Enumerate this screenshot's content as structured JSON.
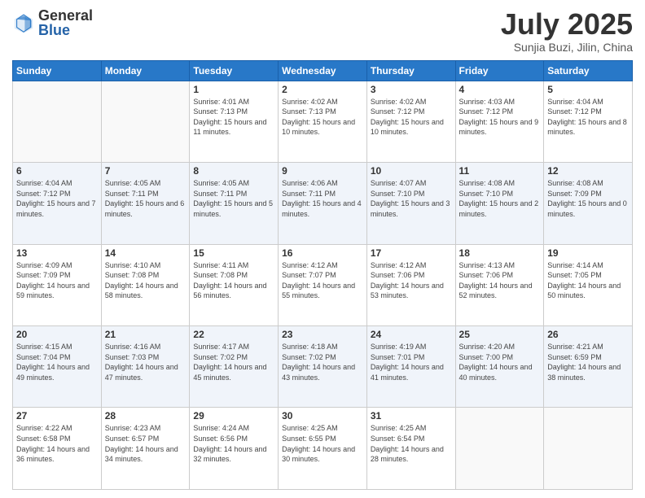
{
  "logo": {
    "general": "General",
    "blue": "Blue"
  },
  "header": {
    "month": "July 2025",
    "location": "Sunjia Buzi, Jilin, China"
  },
  "days_of_week": [
    "Sunday",
    "Monday",
    "Tuesday",
    "Wednesday",
    "Thursday",
    "Friday",
    "Saturday"
  ],
  "weeks": [
    [
      {
        "day": "",
        "info": ""
      },
      {
        "day": "",
        "info": ""
      },
      {
        "day": "1",
        "info": "Sunrise: 4:01 AM\nSunset: 7:13 PM\nDaylight: 15 hours and 11 minutes."
      },
      {
        "day": "2",
        "info": "Sunrise: 4:02 AM\nSunset: 7:13 PM\nDaylight: 15 hours and 10 minutes."
      },
      {
        "day": "3",
        "info": "Sunrise: 4:02 AM\nSunset: 7:12 PM\nDaylight: 15 hours and 10 minutes."
      },
      {
        "day": "4",
        "info": "Sunrise: 4:03 AM\nSunset: 7:12 PM\nDaylight: 15 hours and 9 minutes."
      },
      {
        "day": "5",
        "info": "Sunrise: 4:04 AM\nSunset: 7:12 PM\nDaylight: 15 hours and 8 minutes."
      }
    ],
    [
      {
        "day": "6",
        "info": "Sunrise: 4:04 AM\nSunset: 7:12 PM\nDaylight: 15 hours and 7 minutes."
      },
      {
        "day": "7",
        "info": "Sunrise: 4:05 AM\nSunset: 7:11 PM\nDaylight: 15 hours and 6 minutes."
      },
      {
        "day": "8",
        "info": "Sunrise: 4:05 AM\nSunset: 7:11 PM\nDaylight: 15 hours and 5 minutes."
      },
      {
        "day": "9",
        "info": "Sunrise: 4:06 AM\nSunset: 7:11 PM\nDaylight: 15 hours and 4 minutes."
      },
      {
        "day": "10",
        "info": "Sunrise: 4:07 AM\nSunset: 7:10 PM\nDaylight: 15 hours and 3 minutes."
      },
      {
        "day": "11",
        "info": "Sunrise: 4:08 AM\nSunset: 7:10 PM\nDaylight: 15 hours and 2 minutes."
      },
      {
        "day": "12",
        "info": "Sunrise: 4:08 AM\nSunset: 7:09 PM\nDaylight: 15 hours and 0 minutes."
      }
    ],
    [
      {
        "day": "13",
        "info": "Sunrise: 4:09 AM\nSunset: 7:09 PM\nDaylight: 14 hours and 59 minutes."
      },
      {
        "day": "14",
        "info": "Sunrise: 4:10 AM\nSunset: 7:08 PM\nDaylight: 14 hours and 58 minutes."
      },
      {
        "day": "15",
        "info": "Sunrise: 4:11 AM\nSunset: 7:08 PM\nDaylight: 14 hours and 56 minutes."
      },
      {
        "day": "16",
        "info": "Sunrise: 4:12 AM\nSunset: 7:07 PM\nDaylight: 14 hours and 55 minutes."
      },
      {
        "day": "17",
        "info": "Sunrise: 4:12 AM\nSunset: 7:06 PM\nDaylight: 14 hours and 53 minutes."
      },
      {
        "day": "18",
        "info": "Sunrise: 4:13 AM\nSunset: 7:06 PM\nDaylight: 14 hours and 52 minutes."
      },
      {
        "day": "19",
        "info": "Sunrise: 4:14 AM\nSunset: 7:05 PM\nDaylight: 14 hours and 50 minutes."
      }
    ],
    [
      {
        "day": "20",
        "info": "Sunrise: 4:15 AM\nSunset: 7:04 PM\nDaylight: 14 hours and 49 minutes."
      },
      {
        "day": "21",
        "info": "Sunrise: 4:16 AM\nSunset: 7:03 PM\nDaylight: 14 hours and 47 minutes."
      },
      {
        "day": "22",
        "info": "Sunrise: 4:17 AM\nSunset: 7:02 PM\nDaylight: 14 hours and 45 minutes."
      },
      {
        "day": "23",
        "info": "Sunrise: 4:18 AM\nSunset: 7:02 PM\nDaylight: 14 hours and 43 minutes."
      },
      {
        "day": "24",
        "info": "Sunrise: 4:19 AM\nSunset: 7:01 PM\nDaylight: 14 hours and 41 minutes."
      },
      {
        "day": "25",
        "info": "Sunrise: 4:20 AM\nSunset: 7:00 PM\nDaylight: 14 hours and 40 minutes."
      },
      {
        "day": "26",
        "info": "Sunrise: 4:21 AM\nSunset: 6:59 PM\nDaylight: 14 hours and 38 minutes."
      }
    ],
    [
      {
        "day": "27",
        "info": "Sunrise: 4:22 AM\nSunset: 6:58 PM\nDaylight: 14 hours and 36 minutes."
      },
      {
        "day": "28",
        "info": "Sunrise: 4:23 AM\nSunset: 6:57 PM\nDaylight: 14 hours and 34 minutes."
      },
      {
        "day": "29",
        "info": "Sunrise: 4:24 AM\nSunset: 6:56 PM\nDaylight: 14 hours and 32 minutes."
      },
      {
        "day": "30",
        "info": "Sunrise: 4:25 AM\nSunset: 6:55 PM\nDaylight: 14 hours and 30 minutes."
      },
      {
        "day": "31",
        "info": "Sunrise: 4:25 AM\nSunset: 6:54 PM\nDaylight: 14 hours and 28 minutes."
      },
      {
        "day": "",
        "info": ""
      },
      {
        "day": "",
        "info": ""
      }
    ]
  ]
}
